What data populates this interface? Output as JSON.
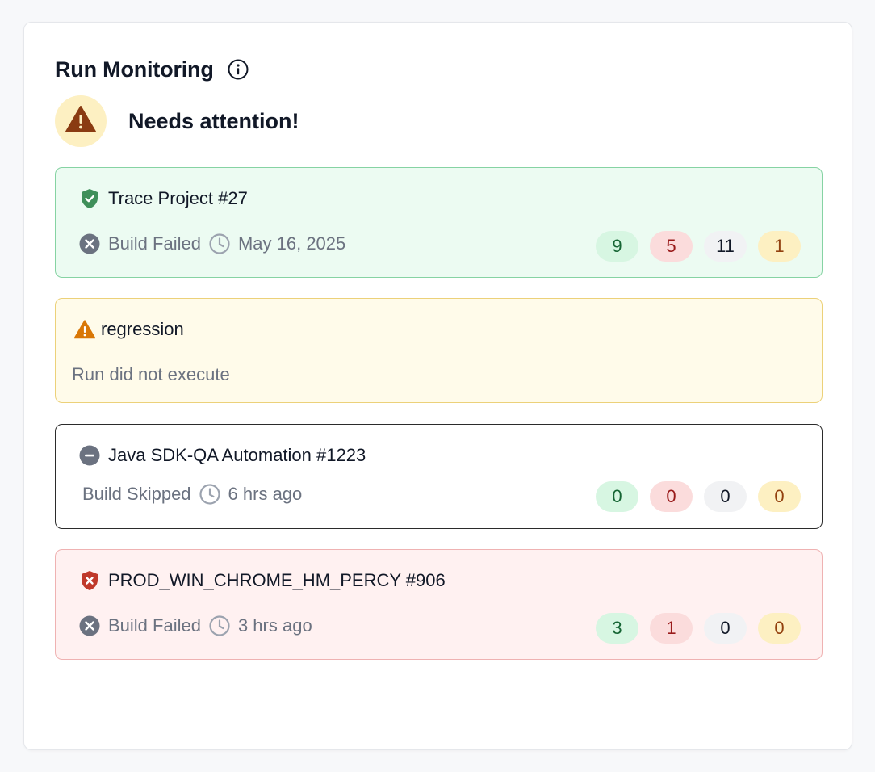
{
  "header": {
    "title": "Run Monitoring",
    "attention_text": "Needs attention!"
  },
  "runs": [
    {
      "title": "Trace Project #27",
      "status_label": "Build Failed",
      "time": "May 16, 2025",
      "counts": [
        "9",
        "5",
        "11",
        "1"
      ]
    },
    {
      "title": "regression",
      "message": "Run did not execute"
    },
    {
      "title": "Java SDK-QA Automation #1223",
      "status_label": "Build Skipped",
      "time": "6 hrs ago",
      "counts": [
        "0",
        "0",
        "0",
        "0"
      ]
    },
    {
      "title": "PROD_WIN_CHROME_HM_PERCY #906",
      "status_label": "Build Failed",
      "time": "3 hrs ago",
      "counts": [
        "3",
        "1",
        "0",
        "0"
      ]
    }
  ],
  "colors": {
    "pass": "#16a34a",
    "fail": "#dc2626",
    "warn": "#d97706",
    "neutral": "#6b7280"
  }
}
